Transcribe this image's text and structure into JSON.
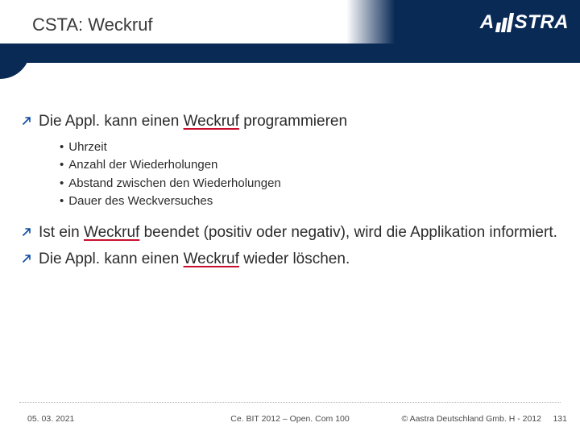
{
  "header": {
    "title": "CSTA: Weckruf",
    "logo_pre": "A",
    "logo_post": "STRA"
  },
  "body": {
    "bullets": [
      {
        "text": "Die Appl. kann einen Weckruf programmieren",
        "underline_word": "Weckruf",
        "sub": [
          "Uhrzeit",
          "Anzahl der Wiederholungen",
          "Abstand zwischen den Wiederholungen",
          "Dauer des Weckversuches"
        ]
      },
      {
        "text": "Ist ein Weckruf beendet (positiv oder negativ), wird die Applikation informiert.",
        "underline_word": "Weckruf"
      },
      {
        "text": "Die Appl. kann einen Weckruf wieder löschen.",
        "underline_word": "Weckruf"
      }
    ]
  },
  "footer": {
    "date": "05. 03. 2021",
    "center": "Ce. BIT 2012 – Open. Com 100",
    "copyright": "© Aastra Deutschland Gmb. H - 2012",
    "page": "131"
  },
  "icons": {
    "bullet_arrow": "arrow-diag-icon"
  },
  "colors": {
    "navy": "#0a2a56",
    "accent_red": "#c8102e"
  }
}
